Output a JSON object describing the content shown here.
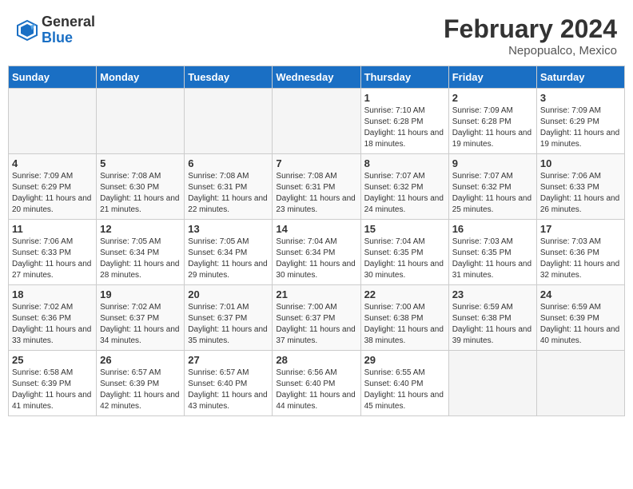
{
  "header": {
    "logo_general": "General",
    "logo_blue": "Blue",
    "title": "February 2024",
    "location": "Nepopualco, Mexico"
  },
  "weekdays": [
    "Sunday",
    "Monday",
    "Tuesday",
    "Wednesday",
    "Thursday",
    "Friday",
    "Saturday"
  ],
  "weeks": [
    [
      {
        "day": "",
        "empty": true
      },
      {
        "day": "",
        "empty": true
      },
      {
        "day": "",
        "empty": true
      },
      {
        "day": "",
        "empty": true
      },
      {
        "day": "1",
        "sunrise": "7:10 AM",
        "sunset": "6:28 PM",
        "daylight": "11 hours and 18 minutes."
      },
      {
        "day": "2",
        "sunrise": "7:09 AM",
        "sunset": "6:28 PM",
        "daylight": "11 hours and 19 minutes."
      },
      {
        "day": "3",
        "sunrise": "7:09 AM",
        "sunset": "6:29 PM",
        "daylight": "11 hours and 19 minutes."
      }
    ],
    [
      {
        "day": "4",
        "sunrise": "7:09 AM",
        "sunset": "6:29 PM",
        "daylight": "11 hours and 20 minutes."
      },
      {
        "day": "5",
        "sunrise": "7:08 AM",
        "sunset": "6:30 PM",
        "daylight": "11 hours and 21 minutes."
      },
      {
        "day": "6",
        "sunrise": "7:08 AM",
        "sunset": "6:31 PM",
        "daylight": "11 hours and 22 minutes."
      },
      {
        "day": "7",
        "sunrise": "7:08 AM",
        "sunset": "6:31 PM",
        "daylight": "11 hours and 23 minutes."
      },
      {
        "day": "8",
        "sunrise": "7:07 AM",
        "sunset": "6:32 PM",
        "daylight": "11 hours and 24 minutes."
      },
      {
        "day": "9",
        "sunrise": "7:07 AM",
        "sunset": "6:32 PM",
        "daylight": "11 hours and 25 minutes."
      },
      {
        "day": "10",
        "sunrise": "7:06 AM",
        "sunset": "6:33 PM",
        "daylight": "11 hours and 26 minutes."
      }
    ],
    [
      {
        "day": "11",
        "sunrise": "7:06 AM",
        "sunset": "6:33 PM",
        "daylight": "11 hours and 27 minutes."
      },
      {
        "day": "12",
        "sunrise": "7:05 AM",
        "sunset": "6:34 PM",
        "daylight": "11 hours and 28 minutes."
      },
      {
        "day": "13",
        "sunrise": "7:05 AM",
        "sunset": "6:34 PM",
        "daylight": "11 hours and 29 minutes."
      },
      {
        "day": "14",
        "sunrise": "7:04 AM",
        "sunset": "6:34 PM",
        "daylight": "11 hours and 30 minutes."
      },
      {
        "day": "15",
        "sunrise": "7:04 AM",
        "sunset": "6:35 PM",
        "daylight": "11 hours and 30 minutes."
      },
      {
        "day": "16",
        "sunrise": "7:03 AM",
        "sunset": "6:35 PM",
        "daylight": "11 hours and 31 minutes."
      },
      {
        "day": "17",
        "sunrise": "7:03 AM",
        "sunset": "6:36 PM",
        "daylight": "11 hours and 32 minutes."
      }
    ],
    [
      {
        "day": "18",
        "sunrise": "7:02 AM",
        "sunset": "6:36 PM",
        "daylight": "11 hours and 33 minutes."
      },
      {
        "day": "19",
        "sunrise": "7:02 AM",
        "sunset": "6:37 PM",
        "daylight": "11 hours and 34 minutes."
      },
      {
        "day": "20",
        "sunrise": "7:01 AM",
        "sunset": "6:37 PM",
        "daylight": "11 hours and 35 minutes."
      },
      {
        "day": "21",
        "sunrise": "7:00 AM",
        "sunset": "6:37 PM",
        "daylight": "11 hours and 37 minutes."
      },
      {
        "day": "22",
        "sunrise": "7:00 AM",
        "sunset": "6:38 PM",
        "daylight": "11 hours and 38 minutes."
      },
      {
        "day": "23",
        "sunrise": "6:59 AM",
        "sunset": "6:38 PM",
        "daylight": "11 hours and 39 minutes."
      },
      {
        "day": "24",
        "sunrise": "6:59 AM",
        "sunset": "6:39 PM",
        "daylight": "11 hours and 40 minutes."
      }
    ],
    [
      {
        "day": "25",
        "sunrise": "6:58 AM",
        "sunset": "6:39 PM",
        "daylight": "11 hours and 41 minutes."
      },
      {
        "day": "26",
        "sunrise": "6:57 AM",
        "sunset": "6:39 PM",
        "daylight": "11 hours and 42 minutes."
      },
      {
        "day": "27",
        "sunrise": "6:57 AM",
        "sunset": "6:40 PM",
        "daylight": "11 hours and 43 minutes."
      },
      {
        "day": "28",
        "sunrise": "6:56 AM",
        "sunset": "6:40 PM",
        "daylight": "11 hours and 44 minutes."
      },
      {
        "day": "29",
        "sunrise": "6:55 AM",
        "sunset": "6:40 PM",
        "daylight": "11 hours and 45 minutes."
      },
      {
        "day": "",
        "empty": true
      },
      {
        "day": "",
        "empty": true
      }
    ]
  ]
}
